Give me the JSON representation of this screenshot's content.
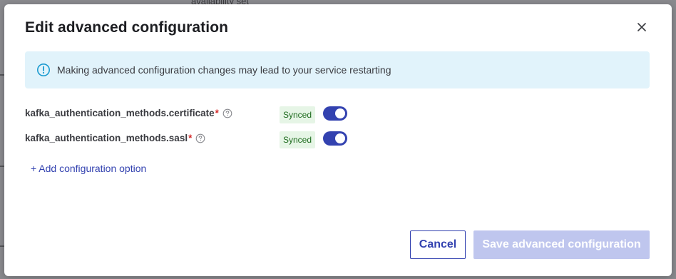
{
  "backdrop": {
    "partial_text": "availability set"
  },
  "modal": {
    "title": "Edit advanced configuration",
    "close_icon": "close-icon",
    "alert": {
      "icon": "info-icon",
      "text": "Making advanced configuration changes may lead to your service restarting",
      "bg_color": "#e1f3fb",
      "accent_color": "#1a9bd0"
    },
    "options": [
      {
        "name": "kafka_authentication_methods.certificate",
        "required_mark": "*",
        "status": "Synced",
        "enabled": true
      },
      {
        "name": "kafka_authentication_methods.sasl",
        "required_mark": "*",
        "status": "Synced",
        "enabled": true
      }
    ],
    "add_option_label": "+ Add configuration option",
    "buttons": {
      "cancel_label": "Cancel",
      "save_label": "Save advanced configuration",
      "save_disabled": true
    },
    "colors": {
      "primary": "#3342b0",
      "primary_disabled": "#bfc6ee",
      "synced_bg": "#e6f5e6",
      "synced_text": "#1e6b1e",
      "required": "#d42a2a"
    }
  }
}
